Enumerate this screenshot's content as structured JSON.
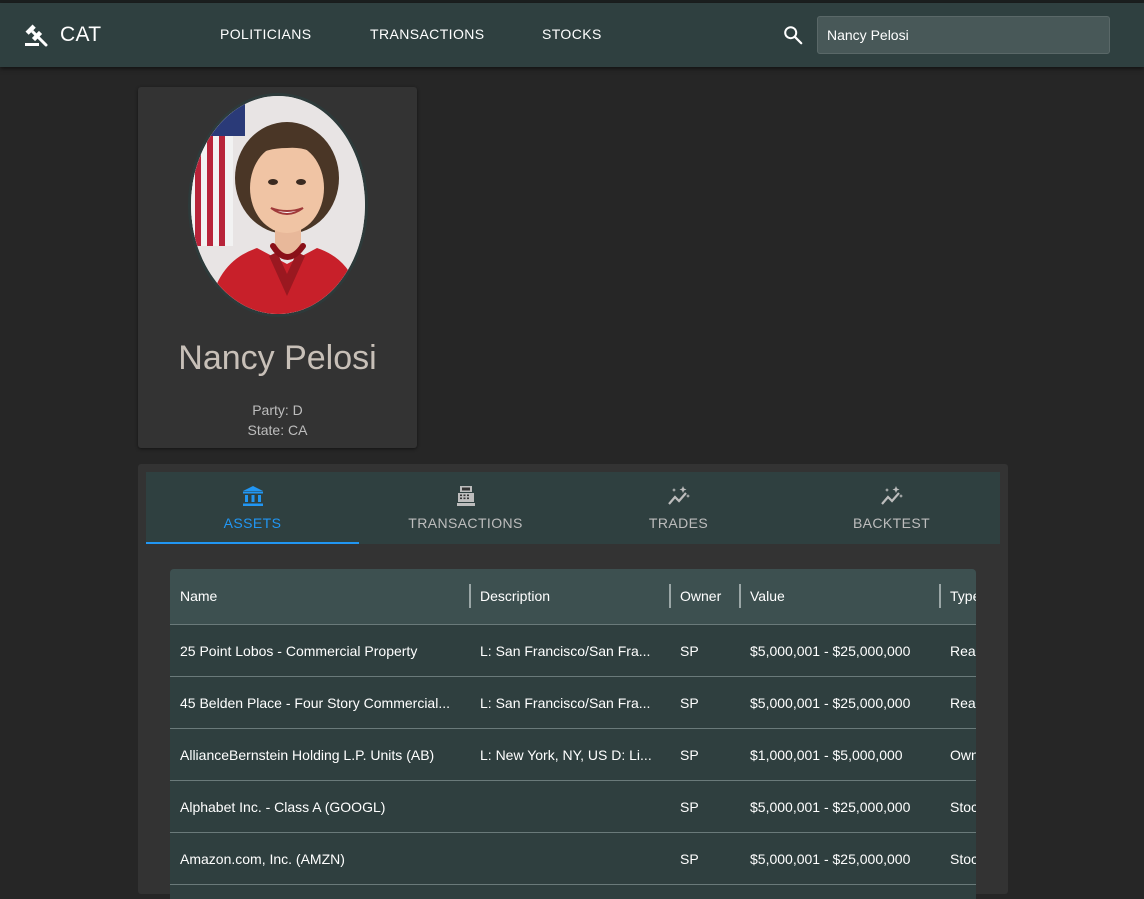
{
  "app": {
    "title": "CAT"
  },
  "nav": {
    "links": [
      "POLITICIANS",
      "TRANSACTIONS",
      "STOCKS"
    ],
    "search_value": "Nancy Pelosi"
  },
  "profile": {
    "name": "Nancy Pelosi",
    "party": "Party: D",
    "state": "State: CA"
  },
  "tabs": [
    {
      "label": "ASSETS",
      "icon": "bank-icon",
      "active": true
    },
    {
      "label": "TRANSACTIONS",
      "icon": "cash-register-icon",
      "active": false
    },
    {
      "label": "TRADES",
      "icon": "chart-sparkle-icon",
      "active": false
    },
    {
      "label": "BACKTEST",
      "icon": "chart-sparkle-icon",
      "active": false
    }
  ],
  "table": {
    "columns": [
      "Name",
      "Description",
      "Owner",
      "Value",
      "Type"
    ],
    "rows": [
      {
        "name": "25 Point Lobos - Commercial Property",
        "description": "L: San Francisco/San Fra...",
        "owner": "SP",
        "value": "$5,000,001 - $25,000,000",
        "type": "Rea"
      },
      {
        "name": "45 Belden Place - Four Story Commercial...",
        "description": "L: San Francisco/San Fra...",
        "owner": "SP",
        "value": "$5,000,001 - $25,000,000",
        "type": "Rea"
      },
      {
        "name": "AllianceBernstein Holding L.P. Units (AB)",
        "description": "L: New York, NY, US D: Li...",
        "owner": "SP",
        "value": "$1,000,001 - $5,000,000",
        "type": "Own"
      },
      {
        "name": "Alphabet Inc. - Class A (GOOGL)",
        "description": "",
        "owner": "SP",
        "value": "$5,000,001 - $25,000,000",
        "type": "Stoc"
      },
      {
        "name": "Amazon.com, Inc. (AMZN)",
        "description": "",
        "owner": "SP",
        "value": "$5,000,001 - $25,000,000",
        "type": "Stoc"
      }
    ]
  },
  "colors": {
    "appbar": "#2f4040",
    "background": "#262626",
    "card": "#333333",
    "accent": "#2196f3"
  }
}
